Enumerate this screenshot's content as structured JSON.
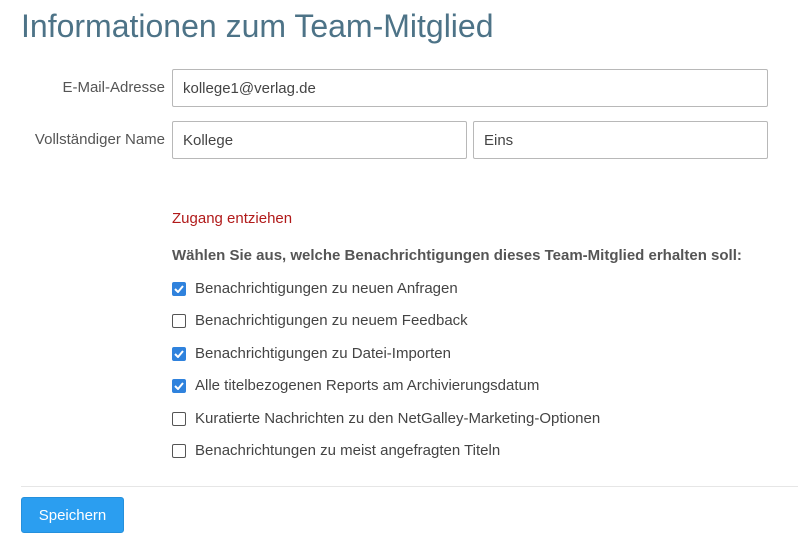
{
  "page": {
    "title": "Informationen zum Team-Mitglied"
  },
  "form": {
    "email_label": "E-Mail-Adresse",
    "email_value": "kollege1@verlag.de",
    "name_label": "Vollständiger Name",
    "first_name_value": "Kollege",
    "last_name_value": "Eins",
    "revoke_access_label": "Zugang entziehen",
    "notifications_heading": "Wählen Sie aus, welche Benachrichtigungen dieses Team-Mitglied erhalten soll:",
    "notifications": [
      {
        "label": "Benachrichtigungen zu neuen Anfragen",
        "checked": true
      },
      {
        "label": "Benachrichtigungen zu neuem Feedback",
        "checked": false
      },
      {
        "label": "Benachrichtigungen zu Datei-Importen",
        "checked": true
      },
      {
        "label": "Alle titelbezogenen Reports am Archivierungsdatum",
        "checked": true
      },
      {
        "label": "Kuratierte Nachrichten zu den NetGalley-Marketing-Optionen",
        "checked": false
      },
      {
        "label": "Benachrichtungen zu meist angefragten Titeln",
        "checked": false
      }
    ],
    "save_label": "Speichern"
  },
  "colors": {
    "title": "#4d7387",
    "link": "#b11a1a",
    "accent": "#2b9ef0",
    "checkbox": "#2f82dd"
  }
}
